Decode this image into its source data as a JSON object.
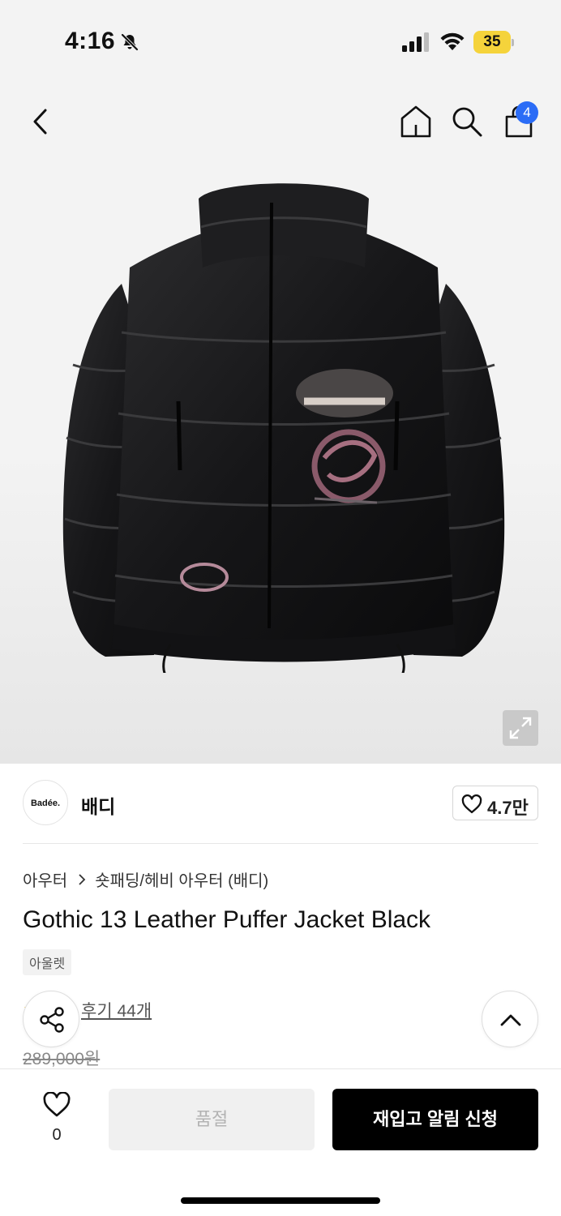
{
  "status_bar": {
    "time": "4:16",
    "battery": "35",
    "icons": [
      "bell-off-icon",
      "signal-icon",
      "wifi-icon",
      "battery-icon"
    ]
  },
  "nav": {
    "icons": [
      "back-icon",
      "home-icon",
      "search-icon",
      "shopping-bag-icon"
    ],
    "cart_count": "4"
  },
  "hero": {
    "image": "black leather puffer jacket",
    "expand_icon": "expand-icon"
  },
  "brand": {
    "logo_text": "Badée.",
    "name": "배디",
    "likes": "4.7만"
  },
  "product": {
    "breadcrumb": [
      "아우터",
      "숏패딩/헤비 아우터 (배디)"
    ],
    "title": "Gothic 13 Leather Puffer Jacket Black",
    "tag": "아울렛",
    "reviews": "후기 44개",
    "original_price": "289,000원"
  },
  "bottom_bar": {
    "wish_count": "0",
    "soldout_label": "품절",
    "restock_label": "재입고 알림 신청"
  },
  "colors": {
    "accent_badge": "#2b6cf6",
    "battery": "#f5d33b",
    "primary_button": "#000000",
    "disabled_button": "#f0f0f0"
  }
}
